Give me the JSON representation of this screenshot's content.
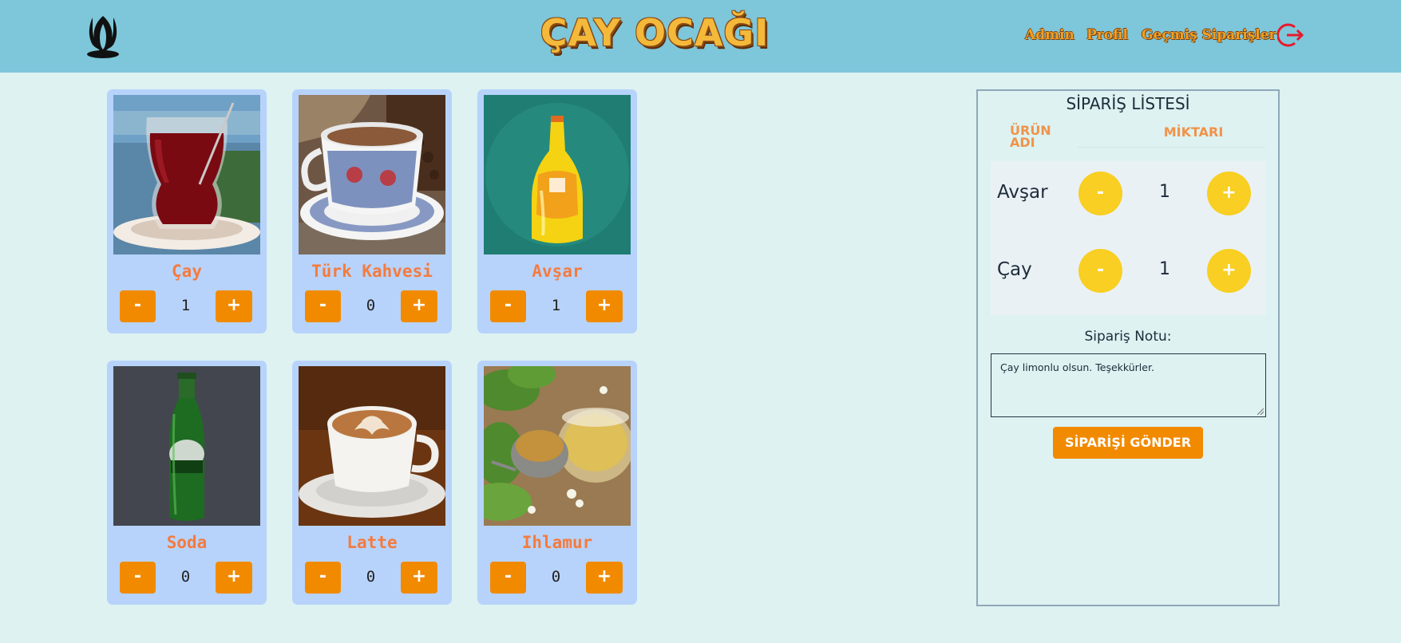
{
  "header": {
    "title": "ÇAY OCAĞI",
    "nav": {
      "admin": "Admin",
      "profile": "Profil",
      "history": "Geçmiş Siparişler"
    },
    "icons": [
      "tulip-logo-icon",
      "logout-icon"
    ]
  },
  "products": [
    {
      "name": "Çay",
      "qty": "1",
      "image": "turkish-tea-glass"
    },
    {
      "name": "Türk Kahvesi",
      "qty": "0",
      "image": "turkish-coffee-cup"
    },
    {
      "name": "Avşar",
      "qty": "1",
      "image": "avsar-soda-bottle"
    },
    {
      "name": "Soda",
      "qty": "0",
      "image": "uludag-soda-bottle"
    },
    {
      "name": "Latte",
      "qty": "0",
      "image": "latte-cup"
    },
    {
      "name": "Ihlamur",
      "qty": "0",
      "image": "linden-tea"
    }
  ],
  "buttons": {
    "minus": "-",
    "plus": "+"
  },
  "order": {
    "title": "SİPARİŞ LİSTESİ",
    "col_name": "ÜRÜN ADI",
    "col_qty": "MİKTARI",
    "items": [
      {
        "name": "Avşar",
        "qty": "1"
      },
      {
        "name": "Çay",
        "qty": "1"
      }
    ],
    "note_label": "Sipariş Notu:",
    "note_value": "Çay limonlu olsun. Teşekkürler.",
    "submit": "SİPARİŞİ GÖNDER"
  },
  "colors": {
    "header_bg": "#7ec6d9",
    "page_bg": "#ddf2f1",
    "card_bg": "#b7d3fb",
    "accent_orange": "#f28a00",
    "product_name": "#f47b3e",
    "circle_yellow": "#f8cf22",
    "logout_red": "#e8192c"
  }
}
